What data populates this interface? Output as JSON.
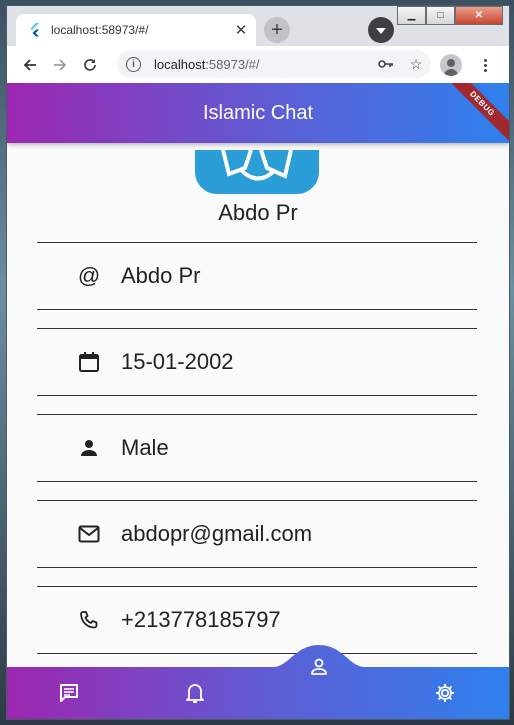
{
  "browser": {
    "tab_title": "localhost:58973/#/",
    "tab_close": "✕",
    "new_tab": "+",
    "url_host": "localhost",
    "url_rest": ":58973/#/"
  },
  "app": {
    "title": "Islamic Chat",
    "debug_banner": "DEBUG",
    "accent_start": "#9c27b0",
    "accent_end": "#2f80ed"
  },
  "profile": {
    "name": "Abdo Pr",
    "fields": [
      {
        "icon": "at-icon",
        "value": "Abdo Pr"
      },
      {
        "icon": "calendar-icon",
        "value": "15-01-2002"
      },
      {
        "icon": "person-icon",
        "value": "Male"
      },
      {
        "icon": "mail-icon",
        "value": "abdopr@gmail.com"
      },
      {
        "icon": "phone-icon",
        "value": "+213778185797"
      }
    ]
  },
  "bottom_nav": {
    "items": [
      "chat-icon",
      "bell-icon",
      "profile-icon",
      "settings-icon"
    ],
    "selected": "profile-icon"
  }
}
